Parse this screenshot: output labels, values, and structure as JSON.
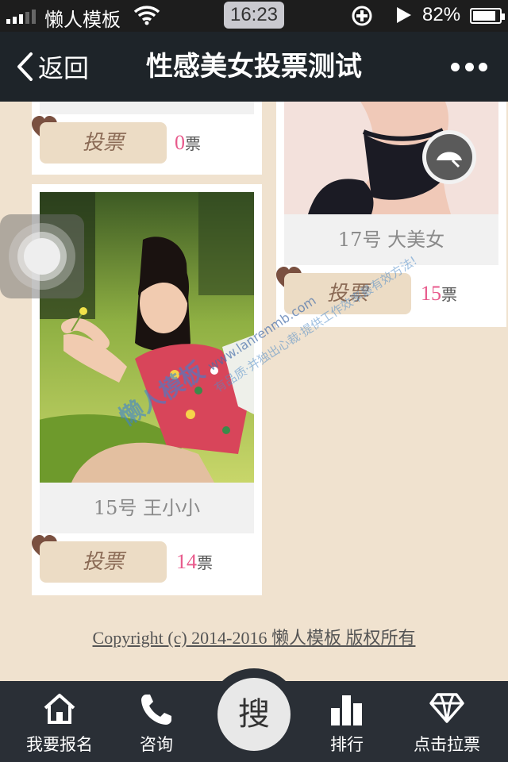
{
  "status_bar": {
    "carrier": "懒人模板",
    "time": "16:23",
    "battery": "82%"
  },
  "header": {
    "back_label": "返回",
    "title": "性感美女投票测试"
  },
  "contestants": [
    {
      "caption": "",
      "vote_label": "投票",
      "votes": "0",
      "unit": "票"
    },
    {
      "caption": "17号 大美女",
      "vote_label": "投票",
      "votes": "15",
      "unit": "票"
    },
    {
      "caption": "15号 王小小",
      "vote_label": "投票",
      "votes": "14",
      "unit": "票"
    }
  ],
  "watermark": {
    "brand": "懒人模板",
    "url": "www.lanrenmb.com",
    "slogan": "有品质·并独出心裁·提供工作效率最有效方法!"
  },
  "footer": {
    "copyright": "Copyright (c) 2014-2016 懒人模板 版权所有"
  },
  "bottom_nav": {
    "items": [
      {
        "label": "我要报名",
        "icon": "home-icon"
      },
      {
        "label": "咨询",
        "icon": "phone-icon"
      },
      {
        "label": "排行",
        "icon": "bar-chart-icon"
      },
      {
        "label": "点击拉票",
        "icon": "diamond-icon"
      }
    ],
    "search_label": "搜"
  },
  "colors": {
    "background": "#f0e2cf",
    "header": "#1e2429",
    "vote_button": "#ecdcc5",
    "vote_count": "#e85a8c",
    "nav": "#2a2f36"
  }
}
